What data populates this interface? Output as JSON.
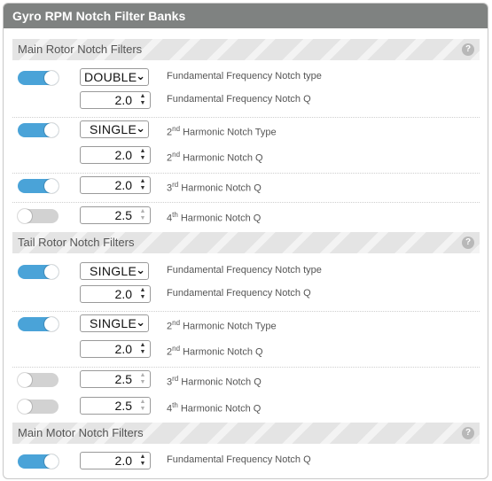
{
  "panel": {
    "title": "Gyro RPM Notch Filter Banks"
  },
  "sections": {
    "main_rotor": {
      "title": "Main Rotor Notch Filters",
      "help": "?",
      "rows": [
        {
          "enabled": true,
          "type": "DOUBLE",
          "type_label": "Fundamental Frequency Notch type",
          "q": "2.0",
          "q_label": "Fundamental Frequency Notch Q"
        },
        {
          "enabled": true,
          "type": "SINGLE",
          "type_label_sup": "nd",
          "type_label_prefix": "2",
          "type_label_rest": " Harmonic Notch Type",
          "q": "2.0",
          "q_label_prefix": "2",
          "q_label_sup": "nd",
          "q_label_rest": " Harmonic Notch Q"
        },
        {
          "enabled": true,
          "q": "2.0",
          "q_label_prefix": "3",
          "q_label_sup": "rd",
          "q_label_rest": " Harmonic Notch Q"
        },
        {
          "enabled": false,
          "q": "2.5",
          "q_label_prefix": "4",
          "q_label_sup": "th",
          "q_label_rest": " Harmonic Notch Q"
        }
      ]
    },
    "tail_rotor": {
      "title": "Tail Rotor Notch Filters",
      "help": "?",
      "rows": [
        {
          "enabled": true,
          "type": "SINGLE",
          "type_label": "Fundamental Frequency Notch type",
          "q": "2.0",
          "q_label": "Fundamental Frequency Notch Q"
        },
        {
          "enabled": true,
          "type": "SINGLE",
          "type_label_prefix": "2",
          "type_label_sup": "nd",
          "type_label_rest": " Harmonic Notch Type",
          "q": "2.0",
          "q_label_prefix": "2",
          "q_label_sup": "nd",
          "q_label_rest": " Harmonic Notch Q"
        },
        {
          "enabled": false,
          "q": "2.5",
          "q_label_prefix": "3",
          "q_label_sup": "rd",
          "q_label_rest": " Harmonic Notch Q"
        },
        {
          "enabled": false,
          "q": "2.5",
          "q_label_prefix": "4",
          "q_label_sup": "th",
          "q_label_rest": " Harmonic Notch Q"
        }
      ]
    },
    "main_motor": {
      "title": "Main Motor Notch Filters",
      "help": "?",
      "rows": [
        {
          "enabled": true,
          "q": "2.0",
          "q_label": "Fundamental Frequency Notch Q"
        }
      ]
    }
  },
  "icons": {
    "chevron": "chevron-down-icon",
    "spinner": "spinner-arrows-icon",
    "help": "help-icon"
  },
  "colors": {
    "header": "#7f8281",
    "toggle_on": "#4aa3d8",
    "toggle_off": "#d2d2d2"
  }
}
